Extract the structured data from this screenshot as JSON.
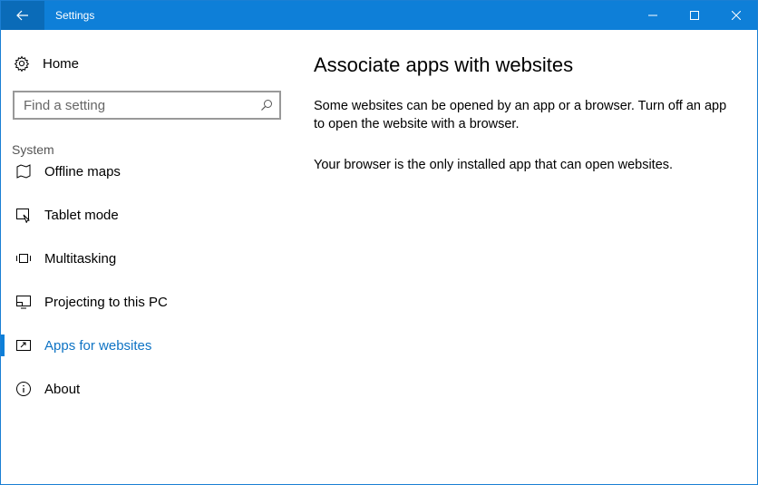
{
  "window": {
    "title": "Settings"
  },
  "sidebar": {
    "home_label": "Home",
    "search": {
      "placeholder": "Find a setting",
      "value": ""
    },
    "section_label": "System",
    "items": [
      {
        "label": "Offline maps",
        "icon": "map-icon",
        "active": false
      },
      {
        "label": "Tablet mode",
        "icon": "tablet-mode-icon",
        "active": false
      },
      {
        "label": "Multitasking",
        "icon": "multitasking-icon",
        "active": false
      },
      {
        "label": "Projecting to this PC",
        "icon": "projecting-icon",
        "active": false
      },
      {
        "label": "Apps for websites",
        "icon": "apps-for-websites-icon",
        "active": true
      },
      {
        "label": "About",
        "icon": "info-icon",
        "active": false
      }
    ]
  },
  "content": {
    "title": "Associate apps with websites",
    "description": "Some websites can be opened by an app or a browser.  Turn off an app to open the website with a browser.",
    "status": "Your browser is the only installed app that can open websites."
  },
  "colors": {
    "accent": "#0e7fd8",
    "titlebar": "#0e7fd8",
    "back_button": "#0a6bb8",
    "active_text": "#0e73c4"
  }
}
